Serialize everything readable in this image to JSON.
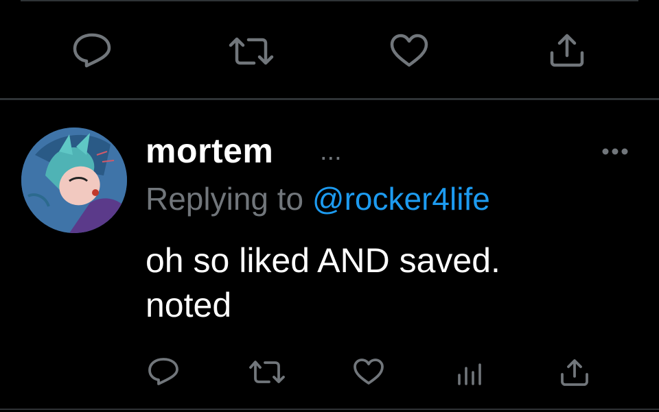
{
  "reply": {
    "author_name": "mortem",
    "name_suffix": "...",
    "replying_prefix": "Replying to",
    "replying_to": "@rocker4life",
    "text_line1": "oh so liked AND saved.",
    "text_line2": "noted"
  },
  "icons": {
    "reply": "reply-bubble-icon",
    "retweet": "retweet-icon",
    "like": "heart-icon",
    "share": "share-icon",
    "analytics": "analytics-icon",
    "more": "more-options-icon"
  },
  "colors": {
    "background": "#000000",
    "text": "#ffffff",
    "muted": "#71767b",
    "accent": "#1d9bf0",
    "divider": "#2f3336"
  }
}
